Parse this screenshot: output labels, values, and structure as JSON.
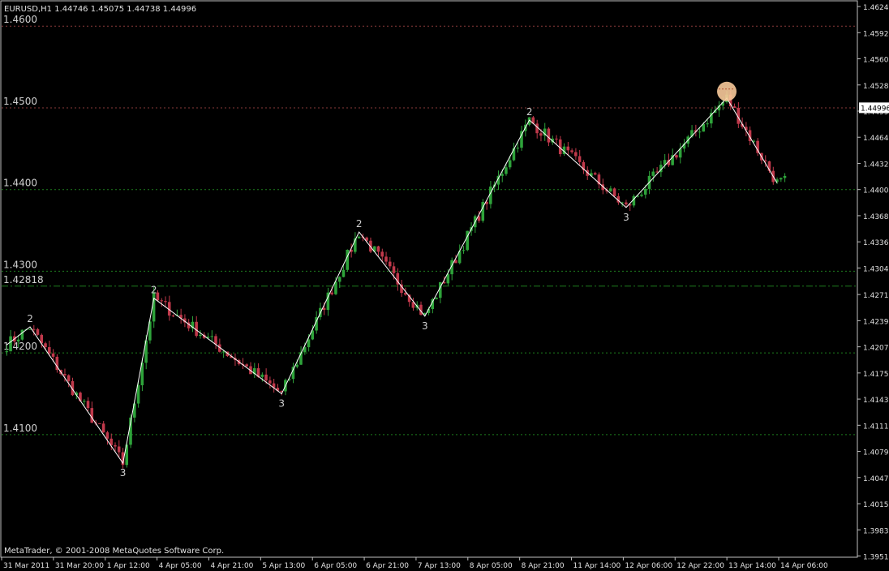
{
  "window": {
    "header": "EURUSD,H1  1.44746 1.45075 1.44738 1.44996",
    "copyright": "MetaTrader, © 2001-2008 MetaQuotes Software Corp."
  },
  "colors": {
    "background": "#000000",
    "frame": "#c0c0c0",
    "bull_candle": "#2ea33a",
    "bear_candle": "#c0394b",
    "grid_green": "#1e7d1e",
    "level_red": "#8a3a3a",
    "zigzag": "#ffffff",
    "label_text": "#d0d0d0",
    "marker_circle": "#f7c99a"
  },
  "chart_data": {
    "type": "candlestick",
    "symbol": "EURUSD",
    "timeframe": "H1",
    "ohlc_current": {
      "open": 1.44746,
      "high": 1.45075,
      "low": 1.44738,
      "close": 1.44996
    },
    "ylim": [
      1.395,
      1.463
    ],
    "y_ticks": [
      1.4624,
      1.4592,
      1.456,
      1.4528,
      1.4496,
      1.4464,
      1.4432,
      1.44,
      1.4368,
      1.4336,
      1.4304,
      1.42715,
      1.42395,
      1.42075,
      1.41755,
      1.41435,
      1.41115,
      1.40795,
      1.40475,
      1.40155,
      1.39835,
      1.39515
    ],
    "y_tick_labels": [
      "1.46240",
      "1.45920",
      "1.45600",
      "1.45280",
      "1.44996",
      "1.44640",
      "1.44320",
      "1.44000",
      "1.43680",
      "1.43360",
      "1.43040",
      "1.42715",
      "1.42395",
      "1.42075",
      "1.41755",
      "1.41435",
      "1.41115",
      "1.40795",
      "1.40475",
      "1.40155",
      "1.39835",
      "1.39515"
    ],
    "current_price_label": "1.44996",
    "x_tick_labels": [
      "31 Mar 2011",
      "31 Mar 20:00",
      "1 Apr 12:00",
      "4 Apr 05:00",
      "4 Apr 21:00",
      "5 Apr 13:00",
      "6 Apr 05:00",
      "6 Apr 21:00",
      "7 Apr 13:00",
      "8 Apr 05:00",
      "8 Apr 21:00",
      "11 Apr 14:00",
      "12 Apr 06:00",
      "12 Apr 22:00",
      "13 Apr 14:00",
      "14 Apr 06:00"
    ],
    "horizontal_levels": [
      {
        "label": "1.4600",
        "price": 1.46,
        "style": "red-dotted"
      },
      {
        "label": "1.4500",
        "price": 1.45,
        "style": "red-dotted"
      },
      {
        "label": "1.4400",
        "price": 1.44,
        "style": "green-dotted"
      },
      {
        "label": "1.4300",
        "price": 1.43,
        "style": "green-dotted"
      },
      {
        "label": "1.42818",
        "price": 1.42818,
        "style": "green-dashdot"
      },
      {
        "label": "1.4200",
        "price": 1.42,
        "style": "green-dotted"
      },
      {
        "label": "1.4100",
        "price": 1.41,
        "style": "green-dotted"
      }
    ],
    "zigzag": [
      {
        "bar": 0,
        "price": 1.421,
        "label": ""
      },
      {
        "bar": 6,
        "price": 1.4232,
        "label": "2"
      },
      {
        "bar": 30,
        "price": 1.4065,
        "label": "3"
      },
      {
        "bar": 38,
        "price": 1.4267,
        "label": "2"
      },
      {
        "bar": 71,
        "price": 1.415,
        "label": "3"
      },
      {
        "bar": 91,
        "price": 1.4348,
        "label": "2"
      },
      {
        "bar": 108,
        "price": 1.4245,
        "label": "3"
      },
      {
        "bar": 135,
        "price": 1.4485,
        "label": "2"
      },
      {
        "bar": 160,
        "price": 1.4378,
        "label": "3"
      },
      {
        "bar": 186,
        "price": 1.4512,
        "label": ""
      },
      {
        "bar": 199,
        "price": 1.4408,
        "label": ""
      }
    ],
    "marker": {
      "bar": 186,
      "price": 1.452
    },
    "total_bars": 202
  }
}
